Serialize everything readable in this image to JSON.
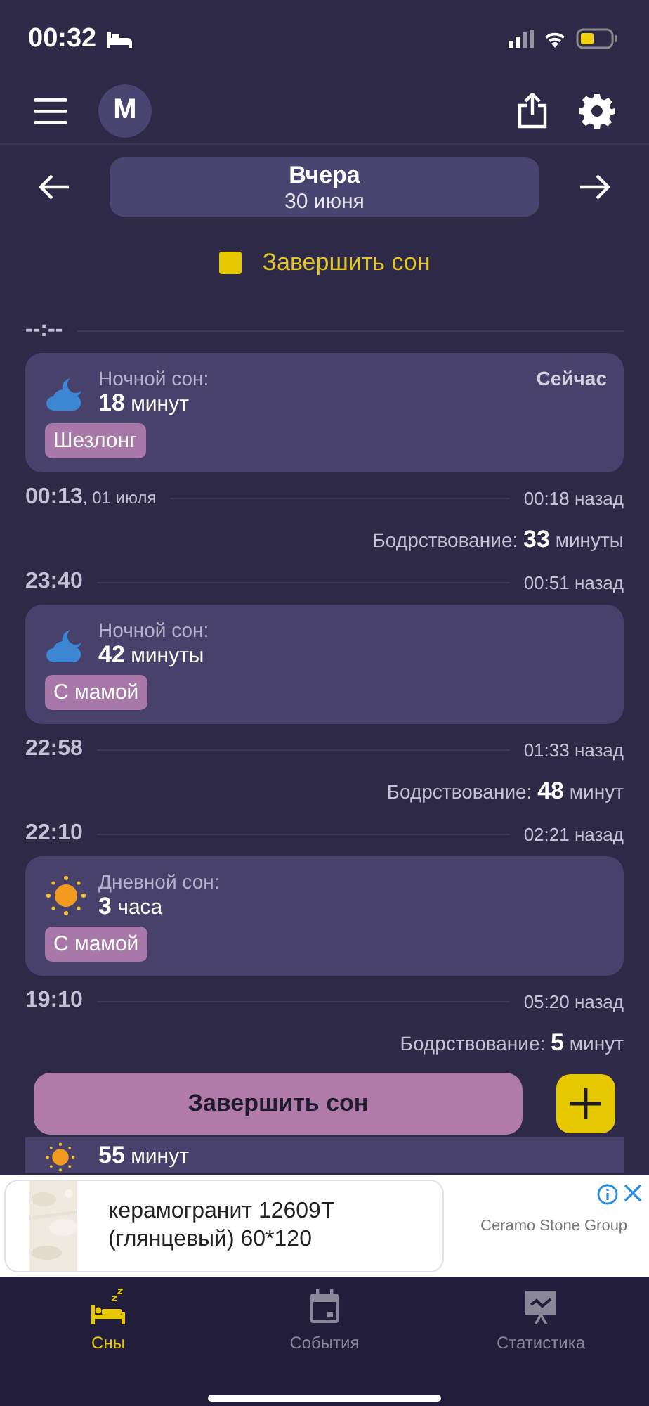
{
  "status_bar": {
    "time": "00:32"
  },
  "header": {
    "avatar": "M"
  },
  "date_nav": {
    "title": "Вчера",
    "subtitle": "30 июня"
  },
  "end_sleep_toggle": {
    "label": "Завершить сон"
  },
  "timeline": [
    {
      "kind": "divider",
      "time": "--:--"
    },
    {
      "kind": "sleep",
      "daytime": false,
      "label": "Ночной сон:",
      "duration": "**18** минут",
      "note": "Сейчас",
      "badge": "Шезлонг"
    },
    {
      "kind": "divider",
      "time": "00:13",
      "date": ", 01 июля",
      "ago": "00:18 назад"
    },
    {
      "kind": "awake",
      "text": "Бодрствование: **33** минуты"
    },
    {
      "kind": "divider",
      "time": "23:40",
      "ago": "00:51 назад"
    },
    {
      "kind": "sleep",
      "daytime": false,
      "label": "Ночной сон:",
      "duration": "**42** минуты",
      "badge": "С мамой"
    },
    {
      "kind": "divider",
      "time": "22:58",
      "ago": "01:33 назад"
    },
    {
      "kind": "awake",
      "text": "Бодрствование: **48** минут"
    },
    {
      "kind": "divider",
      "time": "22:10",
      "ago": "02:21 назад"
    },
    {
      "kind": "sleep",
      "daytime": true,
      "label": "Дневной сон:",
      "duration": "**3** часа",
      "badge": "С мамой"
    },
    {
      "kind": "divider",
      "time": "19:10",
      "ago": "05:20 назад"
    },
    {
      "kind": "awake",
      "text": "Бодрствование: **5** минут"
    },
    {
      "kind": "hidden"
    },
    {
      "kind": "sleep",
      "daytime": true,
      "duration": "**55** минут"
    }
  ],
  "floating_actions": {
    "button": "Завершить сон"
  },
  "ad": {
    "text": "керамогранит 12609T (глянцевый) 60*120",
    "advertiser": "Ceramo Stone Group"
  },
  "tabs": [
    {
      "label": "Сны",
      "selected": true
    },
    {
      "label": "События",
      "selected": false
    },
    {
      "label": "Статистика",
      "selected": false
    }
  ]
}
